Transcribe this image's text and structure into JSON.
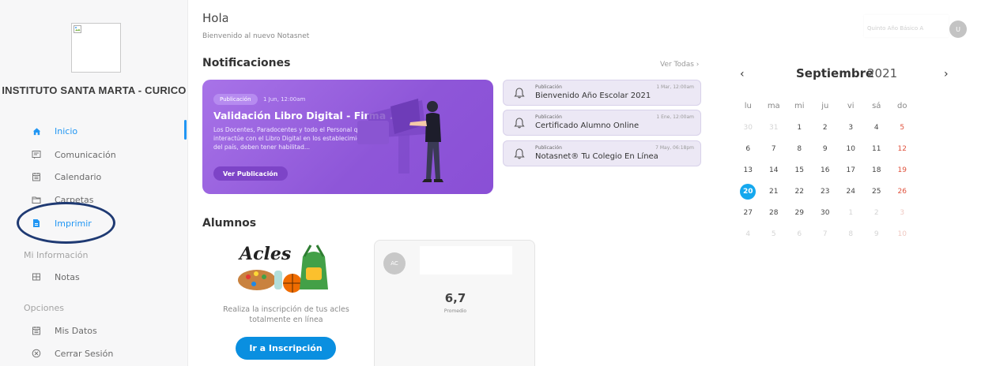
{
  "sidebar": {
    "school_name": "INSTITUTO SANTA MARTA - CURICO",
    "nav": [
      {
        "label": "Inicio",
        "icon": "home-icon"
      },
      {
        "label": "Comunicación",
        "icon": "message-icon"
      },
      {
        "label": "Calendario",
        "icon": "calendar-icon"
      },
      {
        "label": "Carpetas",
        "icon": "folder-icon"
      },
      {
        "label": "Imprimir",
        "icon": "print-file-icon"
      }
    ],
    "section_info": "Mi Información",
    "info_items": [
      {
        "label": "Notas",
        "icon": "grid-icon"
      }
    ],
    "section_options": "Opciones",
    "option_items": [
      {
        "label": "Mis Datos",
        "icon": "calendar-icon"
      },
      {
        "label": "Cerrar Sesión",
        "icon": "close-circle-icon"
      }
    ]
  },
  "header": {
    "greeting": "Hola /",
    "welcome": "Bienvenido al nuevo Notasnet",
    "user_name": "Quinto Año Básico A",
    "user_initial": "U"
  },
  "notifications": {
    "title": "Notificaciones",
    "see_all": "Ver Todas ›",
    "featured": {
      "badge": "Publicación",
      "date": "1 Jun, 12:00am",
      "title": "Validación Libro Digital - Firma ...",
      "body": "Los Docentes, Paradocentes y todo el Personal que interactúe con el Libro Digital en los establecimientos del país, deben tener habilitad...",
      "button": "Ver Publicación"
    },
    "items": [
      {
        "category": "Publicación",
        "date": "1 Mar, 12:00am",
        "title": "Bienvenido Año Escolar 2021"
      },
      {
        "category": "Publicación",
        "date": "1 Ene, 12:00am",
        "title": "Certificado Alumno Online"
      },
      {
        "category": "Publicación",
        "date": "7 May, 06:18pm",
        "title": "Notasnet® Tu Colegio En Línea"
      }
    ]
  },
  "calendar": {
    "prev": "‹",
    "next": "›",
    "month": "Septiembre",
    "year": "2021",
    "weekdays": [
      "lu",
      "ma",
      "mi",
      "ju",
      "vi",
      "sá",
      "do"
    ],
    "weeks": [
      [
        "30",
        "31",
        "1",
        "2",
        "3",
        "4",
        "5"
      ],
      [
        "6",
        "7",
        "8",
        "9",
        "10",
        "11",
        "12"
      ],
      [
        "13",
        "14",
        "15",
        "16",
        "17",
        "18",
        "19"
      ],
      [
        "20",
        "21",
        "22",
        "23",
        "24",
        "25",
        "26"
      ],
      [
        "27",
        "28",
        "29",
        "30",
        "1",
        "2",
        "3"
      ],
      [
        "4",
        "5",
        "6",
        "7",
        "8",
        "9",
        "10"
      ]
    ],
    "today": "20",
    "accent_color": "#15a8ee",
    "weekend_color": "#e0533e"
  },
  "alumnos": {
    "title": "Alumnos",
    "acles_logo_text": "Acles",
    "acles_description": "Realiza la inscripción de tus acles totalmente en línea",
    "acles_button": "Ir a Inscripción",
    "student": {
      "initials": "AC",
      "grade": "6,7",
      "grade_label": "Promedio"
    }
  },
  "colors": {
    "primary": "#2196f3",
    "featured_purple": "#9a62e0",
    "button_blue": "#0a8fe0",
    "highlight_ellipse": "#1f3a73"
  }
}
